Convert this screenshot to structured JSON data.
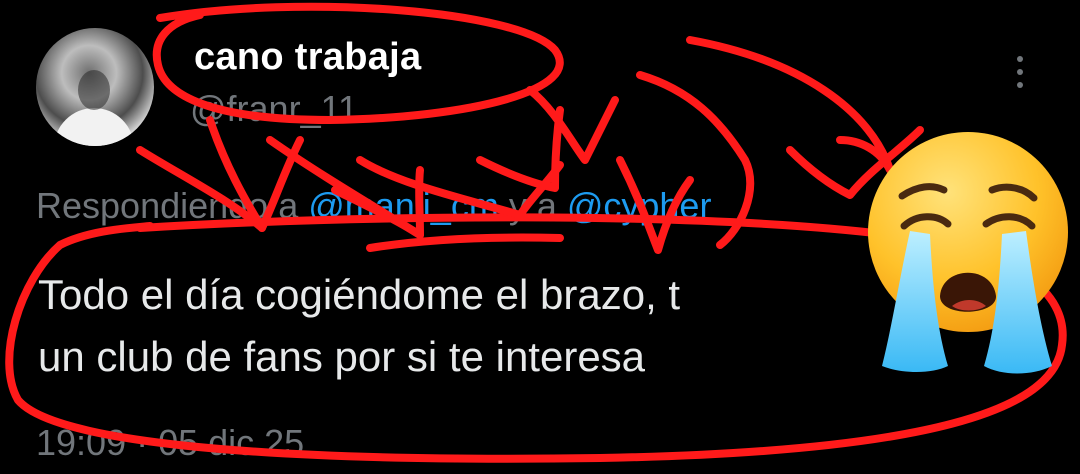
{
  "tweet": {
    "display_name": "cano trabaja",
    "handle": "@franr_11",
    "reply_prefix": "Respondiendo a ",
    "reply_mention_1": "@manii_cm",
    "reply_connector": " y a ",
    "reply_mention_2": "@cypher",
    "text_line_1": "Todo el día cogiéndome el brazo, t",
    "text_line_2": "un club de fans por si te interesa",
    "timestamp": "19:09 · 05 dic 25"
  },
  "icons": {
    "more": "more-vertical-icon",
    "emoji": "crying-face-emoji"
  },
  "colors": {
    "background": "#000000",
    "text_primary": "#e7e9ea",
    "text_secondary": "#71767b",
    "mention": "#1d9bf0",
    "annotation_red": "#ff1a1a"
  }
}
